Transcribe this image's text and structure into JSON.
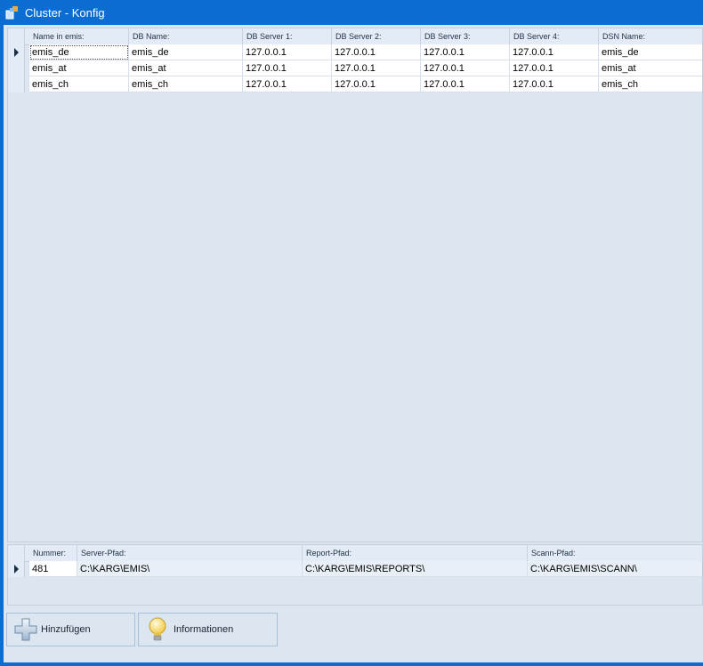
{
  "window": {
    "title": "Cluster - Konfig"
  },
  "cluster_grid": {
    "columns": [
      "Name in emis:",
      "DB Name:",
      "DB Server 1:",
      "DB Server 2:",
      "DB Server 3:",
      "DB Server 4:",
      "DSN Name:"
    ],
    "rows": [
      [
        "emis_de",
        "emis_de",
        "127.0.0.1",
        "127.0.0.1",
        "127.0.0.1",
        "127.0.0.1",
        "emis_de"
      ],
      [
        "emis_at",
        "emis_at",
        "127.0.0.1",
        "127.0.0.1",
        "127.0.0.1",
        "127.0.0.1",
        "emis_at"
      ],
      [
        "emis_ch",
        "emis_ch",
        "127.0.0.1",
        "127.0.0.1",
        "127.0.0.1",
        "127.0.0.1",
        "emis_ch"
      ]
    ]
  },
  "path_grid": {
    "columns": [
      "Nummer:",
      "Server-Pfad:",
      "Report-Pfad:",
      "Scann-Pfad:"
    ],
    "row": [
      "481",
      "C:\\KARG\\EMIS\\",
      "C:\\KARG\\EMIS\\REPORTS\\",
      "C:\\KARG\\EMIS\\SCANN\\"
    ]
  },
  "buttons": {
    "add_label": "Hinzufügen",
    "info_label": "Informationen"
  },
  "icons": {
    "app": "app-icon",
    "add": "plus-icon",
    "info": "lightbulb-icon"
  }
}
